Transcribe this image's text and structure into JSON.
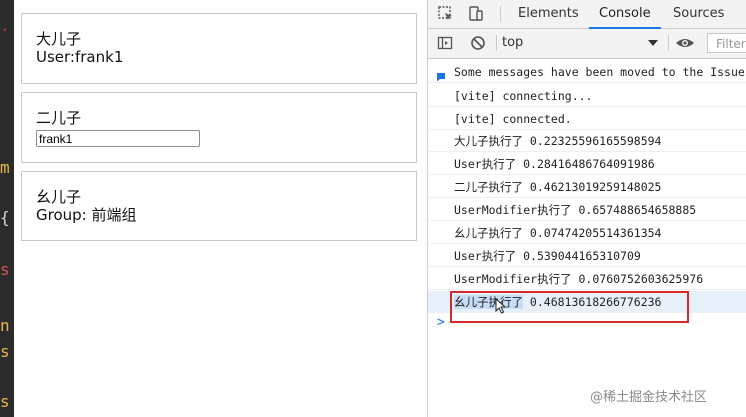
{
  "editor_strip": {
    "fragments": [
      ".",
      "m",
      "{",
      "s",
      "n",
      "s",
      "s"
    ]
  },
  "app": {
    "cards": [
      {
        "title": "大儿子",
        "line2": "User:frank1"
      },
      {
        "title": "二儿子",
        "input_value": "frank1"
      },
      {
        "title": "幺儿子",
        "line2": "Group: 前端组"
      }
    ]
  },
  "devtools": {
    "tabs": [
      {
        "label": "Elements"
      },
      {
        "label": "Console",
        "active": true
      },
      {
        "label": "Sources"
      }
    ],
    "toolbar": {
      "context": "top",
      "filter_placeholder": "Filter"
    },
    "messages": [
      {
        "text": "Some messages have been moved to the Issues panel.",
        "info": true
      },
      {
        "text": "[vite] connecting..."
      },
      {
        "text": "[vite] connected."
      },
      {
        "text": "大儿子执行了 0.22325596165598594"
      },
      {
        "text": "User执行了 0.28416486764091986"
      },
      {
        "text": "二儿子执行了 0.46213019259148025"
      },
      {
        "text": "UserModifier执行了 0.657488654658885"
      },
      {
        "text": "幺儿子执行了 0.07474205514361354"
      },
      {
        "text": "User执行了 0.539044165310709"
      },
      {
        "text": "UserModifier执行了 0.0760752603625976"
      },
      {
        "text_selected": "幺儿子执行了",
        "text_rest": " 0.46813618266776236"
      }
    ],
    "prompt": ">"
  },
  "watermark": "@稀土掘金技术社区",
  "colors": {
    "accent": "#1a73e8",
    "highlight_border": "#d62929",
    "selection": "#c6dcf7"
  }
}
